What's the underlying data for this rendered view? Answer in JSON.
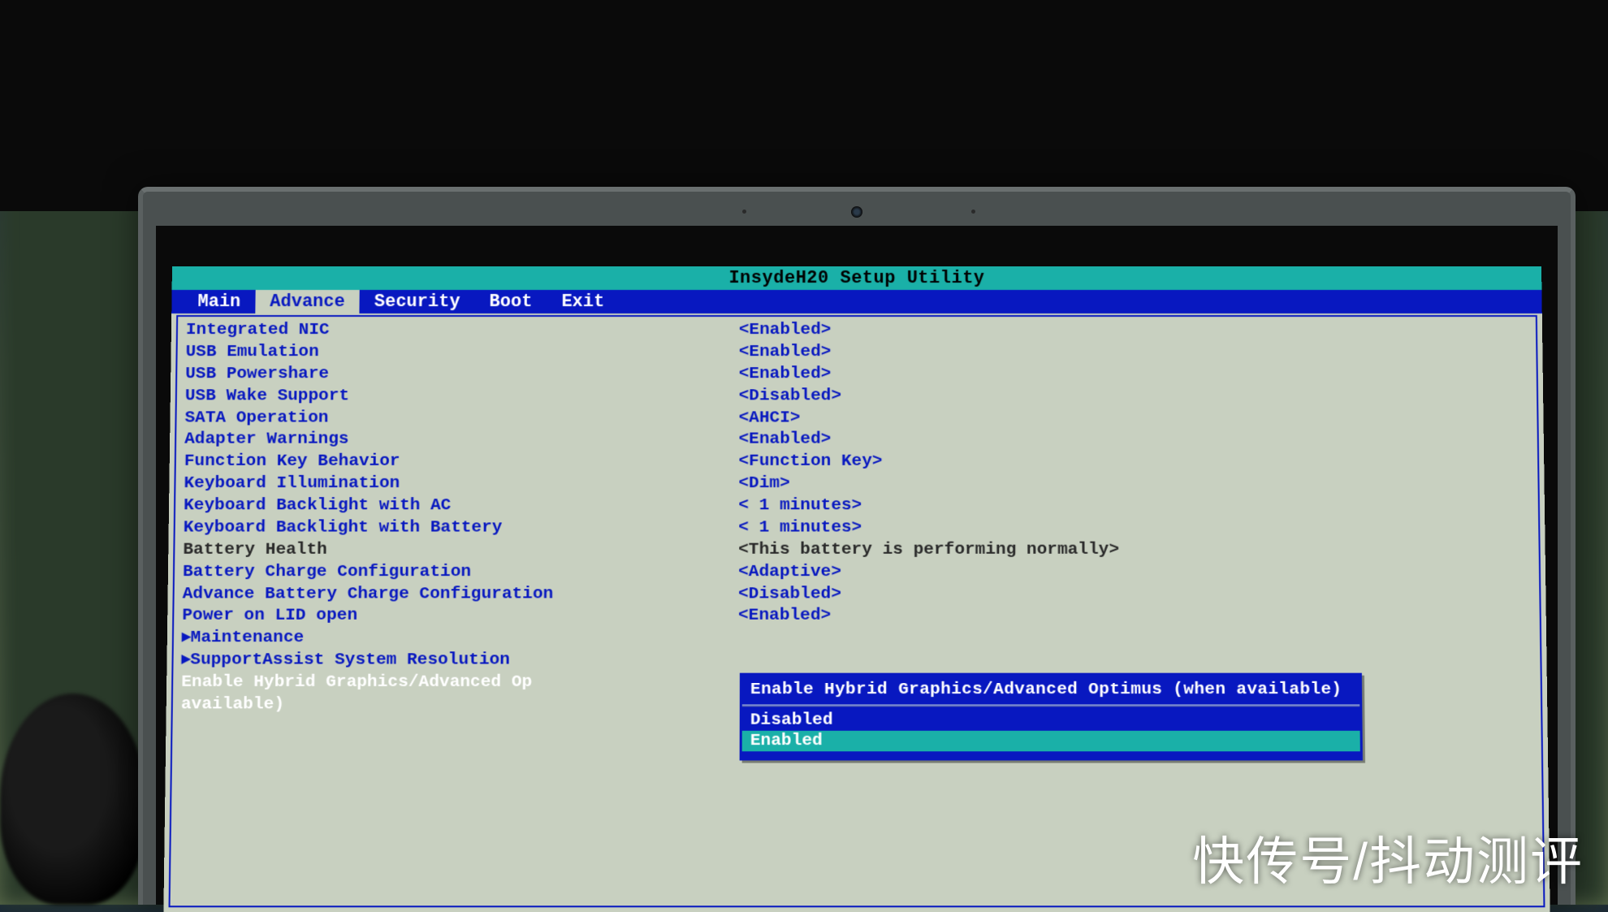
{
  "title": "InsydeH20 Setup Utility",
  "menu": {
    "items": [
      "Main",
      "Advance",
      "Security",
      "Boot",
      "Exit"
    ],
    "active_index": 1
  },
  "settings": [
    {
      "label": "Integrated NIC",
      "value": "<Enabled>",
      "type": "normal"
    },
    {
      "label": "USB Emulation",
      "value": "<Enabled>",
      "type": "normal"
    },
    {
      "label": "USB Powershare",
      "value": "<Enabled>",
      "type": "normal"
    },
    {
      "label": "USB Wake Support",
      "value": "<Disabled>",
      "type": "normal"
    },
    {
      "label": "SATA Operation",
      "value": "<AHCI>",
      "type": "normal"
    },
    {
      "label": "Adapter Warnings",
      "value": "<Enabled>",
      "type": "normal"
    },
    {
      "label": "Function Key Behavior",
      "value": "<Function Key>",
      "type": "normal"
    },
    {
      "label": "Keyboard Illumination",
      "value": "<Dim>",
      "type": "normal"
    },
    {
      "label": "Keyboard Backlight with AC",
      "value": "< 1 minutes>",
      "type": "normal"
    },
    {
      "label": "Keyboard Backlight with Battery",
      "value": "< 1 minutes>",
      "type": "normal"
    },
    {
      "label": "Battery Health",
      "value": "<This battery is performing normally>",
      "type": "dimmed"
    },
    {
      "label": "Battery Charge Configuration",
      "value": "<Adaptive>",
      "type": "normal"
    },
    {
      "label": "Advance Battery Charge Configuration",
      "value": "<Disabled>",
      "type": "normal"
    },
    {
      "label": "Power on LID open",
      "value": "<Enabled>",
      "type": "normal"
    },
    {
      "label": "Maintenance",
      "value": "",
      "type": "submenu"
    },
    {
      "label": "SupportAssist System Resolution",
      "value": "",
      "type": "submenu"
    },
    {
      "label": "Enable Hybrid Graphics/Advanced Op",
      "value": "",
      "type": "selected"
    },
    {
      "label": "available)",
      "value": "",
      "type": "selected"
    }
  ],
  "popup": {
    "title": "Enable Hybrid Graphics/Advanced Optimus (when available)",
    "options": [
      "Disabled",
      "Enabled"
    ],
    "selected_index": 1
  },
  "watermark": "快传号/抖动测评"
}
